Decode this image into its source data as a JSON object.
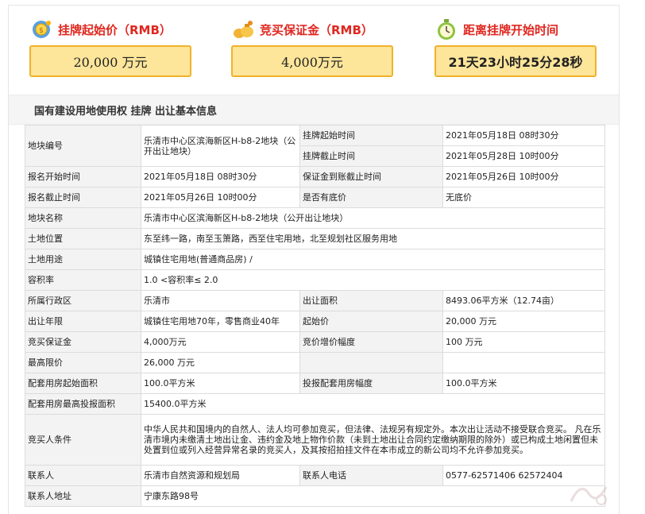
{
  "summary": {
    "start_price": {
      "title": "挂牌起始价（RMB）",
      "icon": "coins-icon",
      "value": "20,000 万元"
    },
    "deposit": {
      "title": "竞买保证金（RMB）",
      "icon": "money-bag-icon",
      "value": "4,000万元"
    },
    "countdown": {
      "title": "距离挂牌开始时间",
      "icon": "clock-icon",
      "value": "21天23小时25分28秒"
    }
  },
  "section_title": "国有建设用地使用权 挂牌 出让基本信息",
  "colors": {
    "title_red": "#e0271f",
    "box_fill": "#fde59a",
    "box_border": "#f0b22a"
  },
  "rows": {
    "parcel_no_label": "地块编号",
    "parcel_no_value": "乐清市中心区滨海新区H-b8-2地块（公开出让地块）",
    "listing_start_label": "挂牌起始时间",
    "listing_start_value": "2021年05月18日 08时30分",
    "listing_end_label": "挂牌截止时间",
    "listing_end_value": "2021年05月28日 10时00分",
    "reg_start_label": "报名开始时间",
    "reg_start_value": "2021年05月18日 08时30分",
    "deposit_deadline_label": "保证金到账截止时间",
    "deposit_deadline_value": "2021年05月26日 10时00分",
    "reg_end_label": "报名截止时间",
    "reg_end_value": "2021年05月26日 10时00分",
    "reserve_label": "是否有底价",
    "reserve_value": "无底价",
    "name_label": "地块名称",
    "name_value": "乐清市中心区滨海新区H-b8-2地块（公开出让地块）",
    "location_label": "土地位置",
    "location_value": "东至纬一路，南至玉箫路，西至住宅用地，北至规划社区服务用地",
    "use_label": "土地用途",
    "use_value": "城镇住宅用地(普通商品房) /",
    "far_label": "容积率",
    "far_value": "1.0 <容积率≤ 2.0",
    "district_label": "所属行政区",
    "district_value": "乐清市",
    "area_label": "出让面积",
    "area_value": "8493.06平方米（12.74亩）",
    "term_label": "出让年限",
    "term_value": "城镇住宅用地70年，零售商业40年",
    "start_price_label": "起始价",
    "start_price_value": "20,000 万元",
    "bid_deposit_label": "竞买保证金",
    "bid_deposit_value": "4,000万元",
    "increment_label": "竞价增价幅度",
    "increment_value": "100 万元",
    "max_price_label": "最高限价",
    "max_price_value": "26,000 万元",
    "housing_start_label": "配套用房起始面积",
    "housing_start_value": "100.0平方米",
    "housing_inc_label": "投报配套用房幅度",
    "housing_inc_value": "100.0平方米",
    "housing_max_label": "配套用房最高投报面积",
    "housing_max_value": "15400.0平方米",
    "bidder_label": "竞买人条件",
    "bidder_value": "中华人民共和国境内的自然人、法人均可参加竞买，但法律、法规另有规定外。本次出让活动不接受联合竞买。 凡在乐清市境内未缴清土地出让金、违约金及地上物作价款（未到土地出让合同约定缴纳期限的除外）或已构成土地闲置但未处置到位或列入经营异常名录的竞买人，及其按招拍挂文件在本市成立的新公司均不允许参加竞买。",
    "contact_label": "联系人",
    "contact_value": "乐清市自然资源和规划局",
    "phone_label": "联系人电话",
    "phone_value": "0577-62571406 62572404",
    "address_label": "联系人地址",
    "address_value": "宁康东路98号"
  }
}
